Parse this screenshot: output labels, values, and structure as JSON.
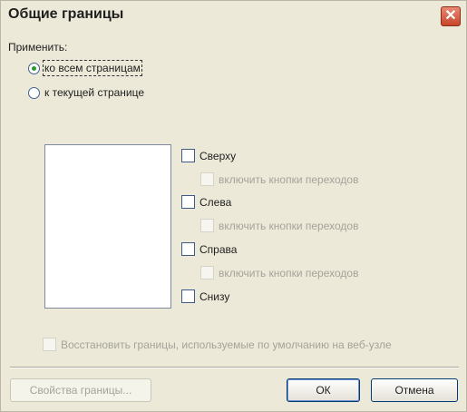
{
  "window": {
    "title": "Общие границы",
    "close_label": "✕"
  },
  "apply_group": {
    "label": "Применить:",
    "options": [
      {
        "label": "ко всем страницам",
        "selected": true
      },
      {
        "label": "к текущей странице",
        "selected": false
      }
    ]
  },
  "borders": [
    {
      "label": "Сверху",
      "checked": false,
      "sub_label": "включить кнопки переходов"
    },
    {
      "label": "Слева",
      "checked": false,
      "sub_label": "включить кнопки переходов"
    },
    {
      "label": "Справа",
      "checked": false,
      "sub_label": "включить кнопки переходов"
    },
    {
      "label": "Снизу",
      "checked": false
    }
  ],
  "restore_default": {
    "label": "Восстановить границы, используемые по умолчанию на веб-узле",
    "enabled": false
  },
  "buttons": {
    "properties": "Свойства границы...",
    "ok": "ОК",
    "cancel": "Отмена"
  },
  "colors": {
    "dialog_bg": "#ece9d8",
    "close_button": "#c8452a",
    "radio_dot": "#2a9a2f"
  }
}
